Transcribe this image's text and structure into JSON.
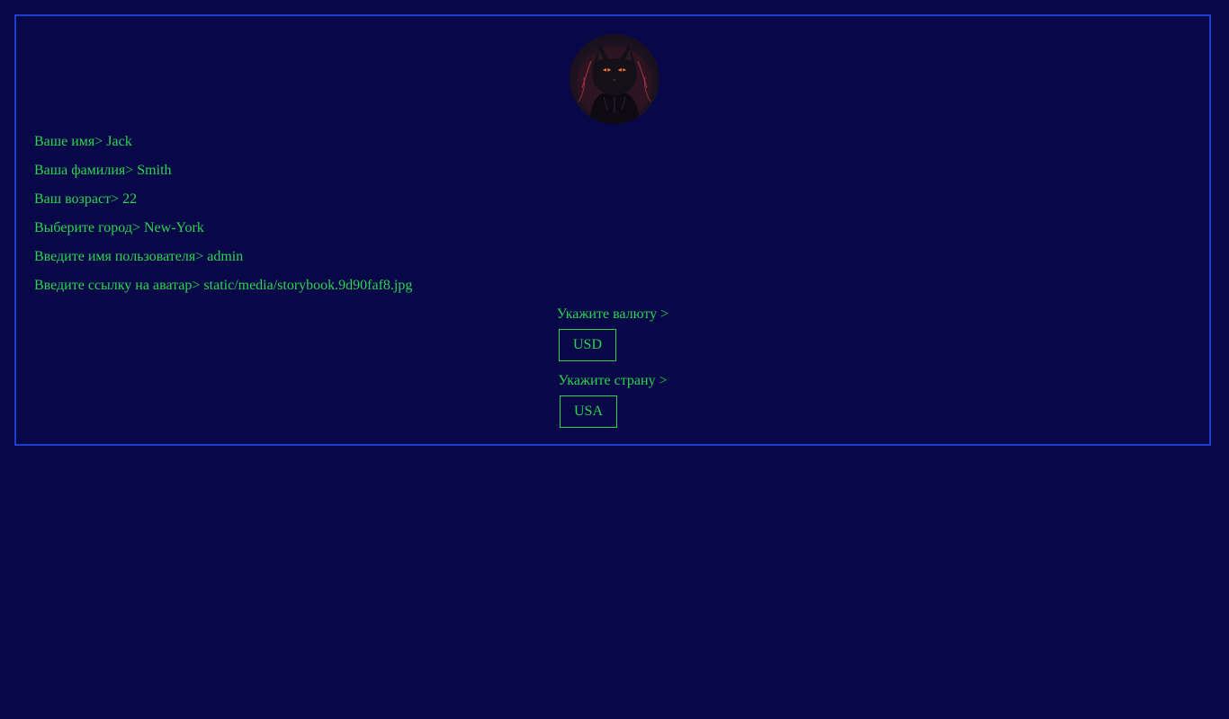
{
  "profile": {
    "fields": [
      {
        "label": "Ваше имя>",
        "value": "Jack"
      },
      {
        "label": "Ваша фамилия>",
        "value": "Smith"
      },
      {
        "label": "Ваш возраст>",
        "value": "22"
      },
      {
        "label": "Выберите город>",
        "value": "New-York"
      },
      {
        "label": "Введите имя пользователя>",
        "value": "admin"
      },
      {
        "label": "Введите ссылку на аватар>",
        "value": "static/media/storybook.9d90faf8.jpg"
      }
    ],
    "currency": {
      "label": "Укажите валюту >",
      "value": "USD"
    },
    "country": {
      "label": "Укажите страну >",
      "value": "USA"
    }
  },
  "colors": {
    "background": "#080849",
    "text": "#2bd44f",
    "panel_border": "#1a3fd1"
  },
  "icons": {
    "avatar": "black-cat-avatar"
  }
}
